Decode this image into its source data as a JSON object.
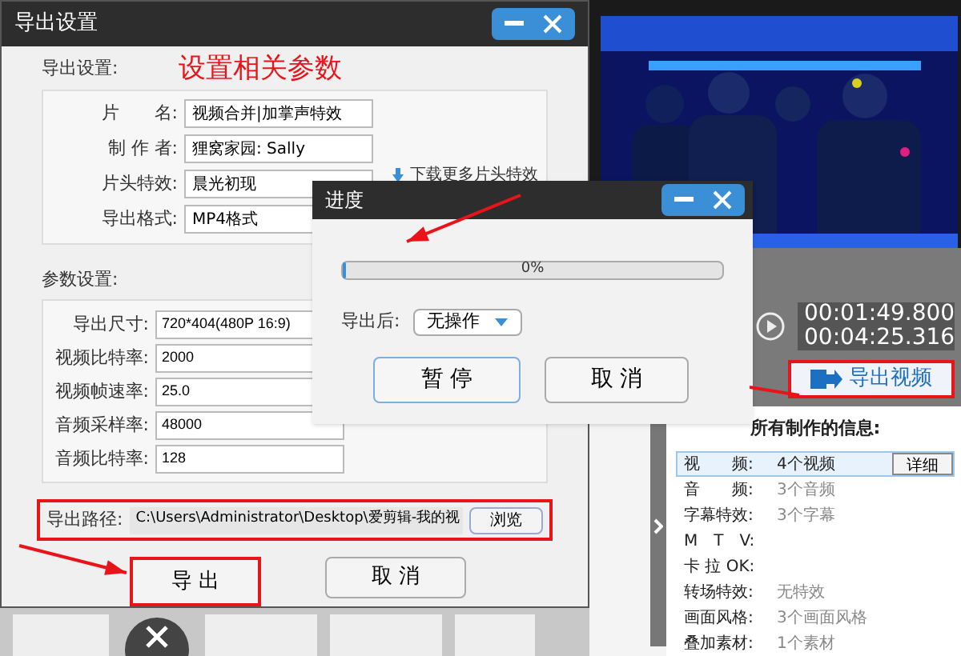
{
  "export_dialog": {
    "title": "导出设置",
    "annotation": "设置相关参数",
    "export_settings": {
      "heading": "导出设置:",
      "fields": [
        {
          "label": "片　　名:",
          "value": "视频合并|加掌声特效",
          "kind": "text"
        },
        {
          "label": "制 作 者:",
          "value": "狸窝家园: Sally",
          "kind": "text"
        },
        {
          "label": "片头特效:",
          "value": "晨光初现",
          "kind": "select"
        },
        {
          "label": "导出格式:",
          "value": "MP4格式",
          "kind": "select"
        }
      ],
      "download_link": "下载更多片头特效"
    },
    "params": {
      "heading": "参数设置:",
      "fields": [
        {
          "label": "导出尺寸:",
          "value": "720*404(480P 16:9)"
        },
        {
          "label": "视频比特率:",
          "value": "2000"
        },
        {
          "label": "视频帧速率:",
          "value": "25.0"
        },
        {
          "label": "音频采样率:",
          "value": "48000"
        },
        {
          "label": "音频比特率:",
          "value": "128"
        }
      ]
    },
    "path": {
      "label": "导出路径:",
      "value": "C:\\Users\\Administrator\\Desktop\\爱剪辑-我的视",
      "browse": "浏览"
    },
    "buttons": [
      {
        "label": "导 出",
        "highlighted": true
      },
      {
        "label": "取 消",
        "highlighted": false
      }
    ]
  },
  "progress_dialog": {
    "title": "进度",
    "progress": {
      "level": 0.01,
      "reading": "0%"
    },
    "after": {
      "label": "导出后:",
      "value": "无操作"
    },
    "buttons": [
      {
        "label": "暂 停",
        "selected": true
      },
      {
        "label": "取 消",
        "selected": false
      }
    ]
  },
  "player": {
    "time_current": "00:01:49.800",
    "time_total": "00:04:25.316",
    "export_button": "导出视频"
  },
  "info": {
    "title": "所有制作的信息:",
    "detail_button": "详细",
    "rows": [
      {
        "label": "视　　频:",
        "value": "4个视频",
        "selected": true
      },
      {
        "label": "音　　频:",
        "value": "3个音频",
        "selected": false
      },
      {
        "label": "字幕特效:",
        "value": "3个字幕",
        "selected": false
      },
      {
        "label": "M　T　V:",
        "value": "",
        "selected": false
      },
      {
        "label": "卡 拉 OK:",
        "value": "",
        "selected": false
      },
      {
        "label": "转场特效:",
        "value": "无特效",
        "selected": false
      },
      {
        "label": "画面风格:",
        "value": "3个画面风格",
        "selected": false
      },
      {
        "label": "叠加素材:",
        "value": "1个素材",
        "selected": false
      }
    ]
  }
}
